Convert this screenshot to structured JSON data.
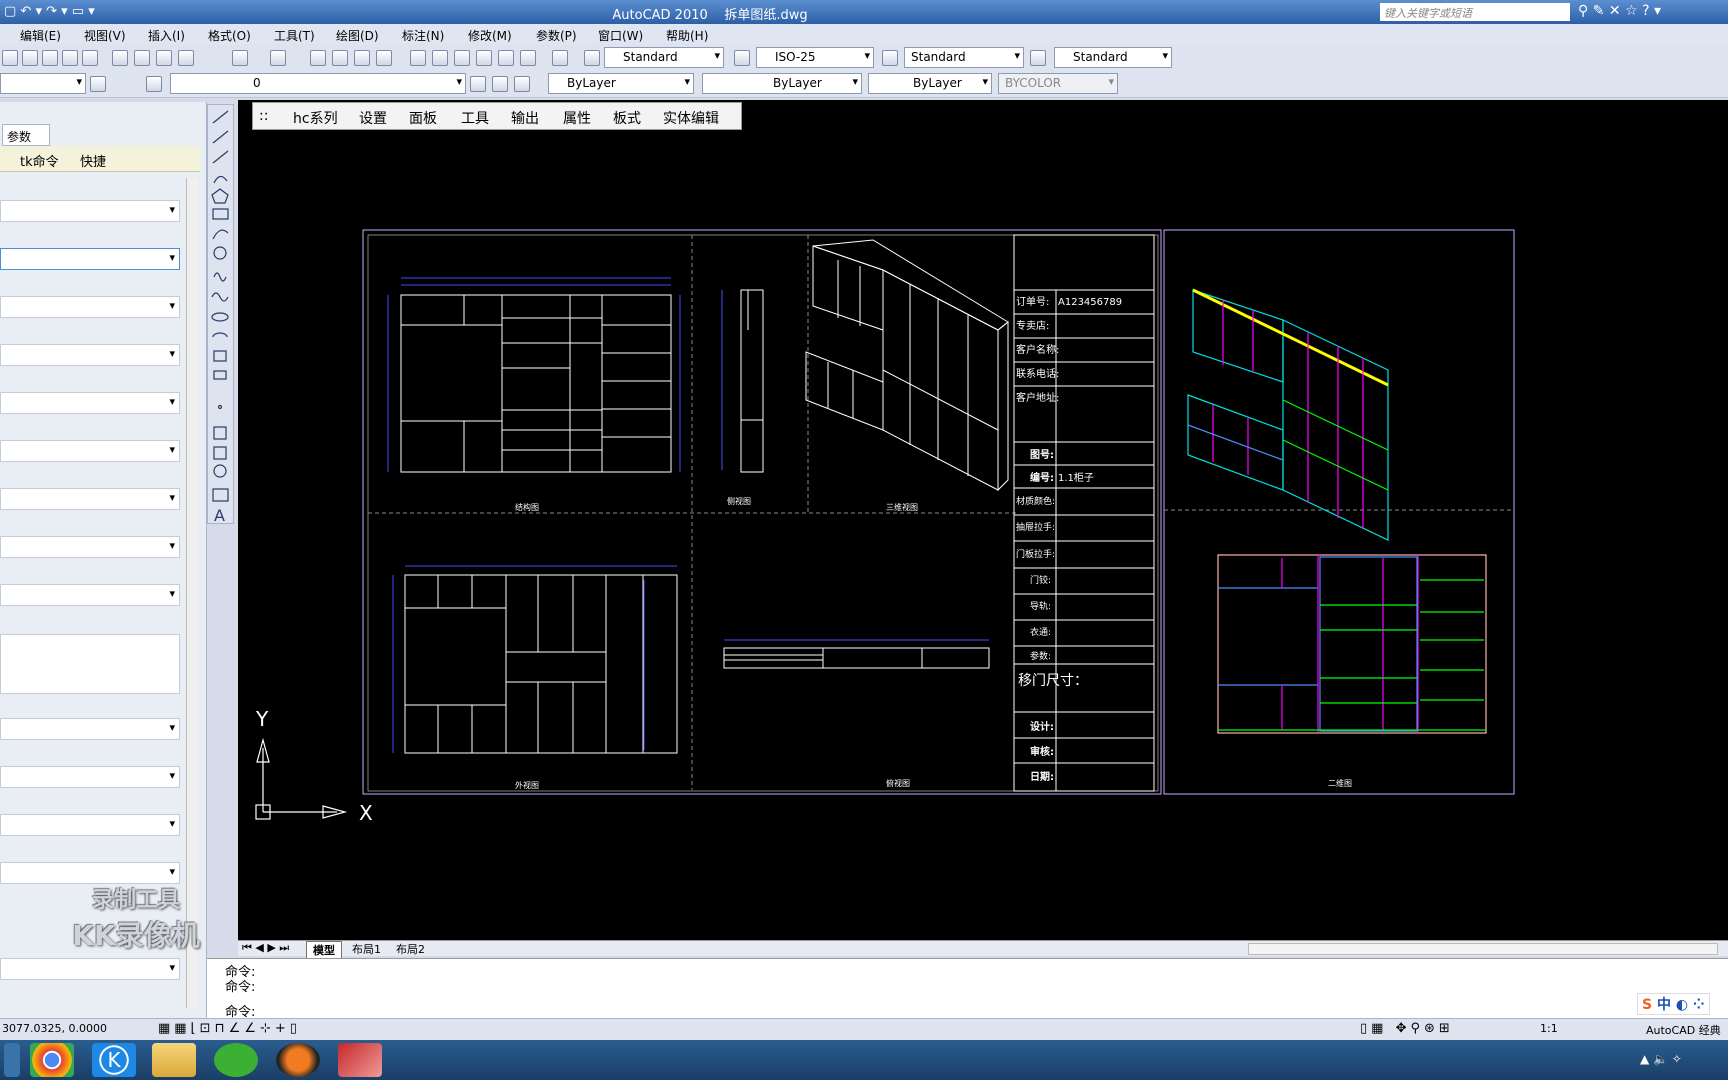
{
  "titlebar": {
    "app": "AutoCAD 2010",
    "file": "拆单图纸.dwg",
    "search_placeholder": "键入关键字或短语"
  },
  "menu": [
    "编辑(E)",
    "视图(V)",
    "插入(I)",
    "格式(O)",
    "工具(T)",
    "绘图(D)",
    "标注(N)",
    "修改(M)",
    "参数(P)",
    "窗口(W)",
    "帮助(H)"
  ],
  "styles": {
    "text_style": "Standard",
    "dim_style": "ISO-25",
    "table_style": "Standard",
    "multileader_style": "Standard"
  },
  "layers": {
    "current": "0",
    "color": "ByLayer",
    "linetype": "ByLayer",
    "lineweight": "ByLayer",
    "plot_style": "BYCOLOR"
  },
  "palette": {
    "tab": "参数",
    "tk_label": "tk命令",
    "quick_label": "快捷"
  },
  "hcbar": {
    "items": [
      "::",
      "hc系列",
      "设置",
      "面板",
      "工具",
      "输出",
      "属性",
      "板式",
      "实体编辑"
    ]
  },
  "drawing": {
    "order_no_label": "订单号:",
    "order_no": "A123456789",
    "store_label": "专卖店:",
    "customer_label": "客户名称:",
    "phone_label": "联系电话:",
    "address_label": "客户地址:",
    "drawing_no_label": "图号:",
    "serial_label": "编号:",
    "serial": "1.1柜子",
    "material_label": "材质颜色:",
    "handle_label": "抽屉拉手:",
    "door_handle_label": "门板拉手:",
    "door_closer_label": "门铰:",
    "rail_label": "导轨:",
    "other_label": "衣通:",
    "param_label": "参数:",
    "sliding_label": "移门尺寸：",
    "design_label": "设计:",
    "review_label": "审核:",
    "date_label": "日期:",
    "view_structure": "结构图",
    "view_side": "侧视图",
    "view_3d": "三维视图",
    "view_front": "外视图",
    "view_top": "俯视图",
    "view_2d": "二维图"
  },
  "ucs": {
    "x": "X",
    "y": "Y"
  },
  "tabs": [
    "模型",
    "布局1",
    "布局2"
  ],
  "command": {
    "lines": [
      "命令:",
      "命令:"
    ],
    "prompt": "命令:"
  },
  "status": {
    "coords": "3077.0325, 0.0000",
    "scale": "1:1",
    "workspace": "AutoCAD 经典"
  },
  "watermark": {
    "line1": "录制工具",
    "line2": "KK录像机"
  },
  "ime": {
    "label": "中"
  },
  "colors": {
    "canvas": "#000000",
    "frame": "#c9a9ff",
    "dim": "#4a4aff",
    "cyan": "#00e0e0",
    "magenta": "#ff00ff",
    "green": "#00ff00",
    "yellow": "#ffff00"
  }
}
